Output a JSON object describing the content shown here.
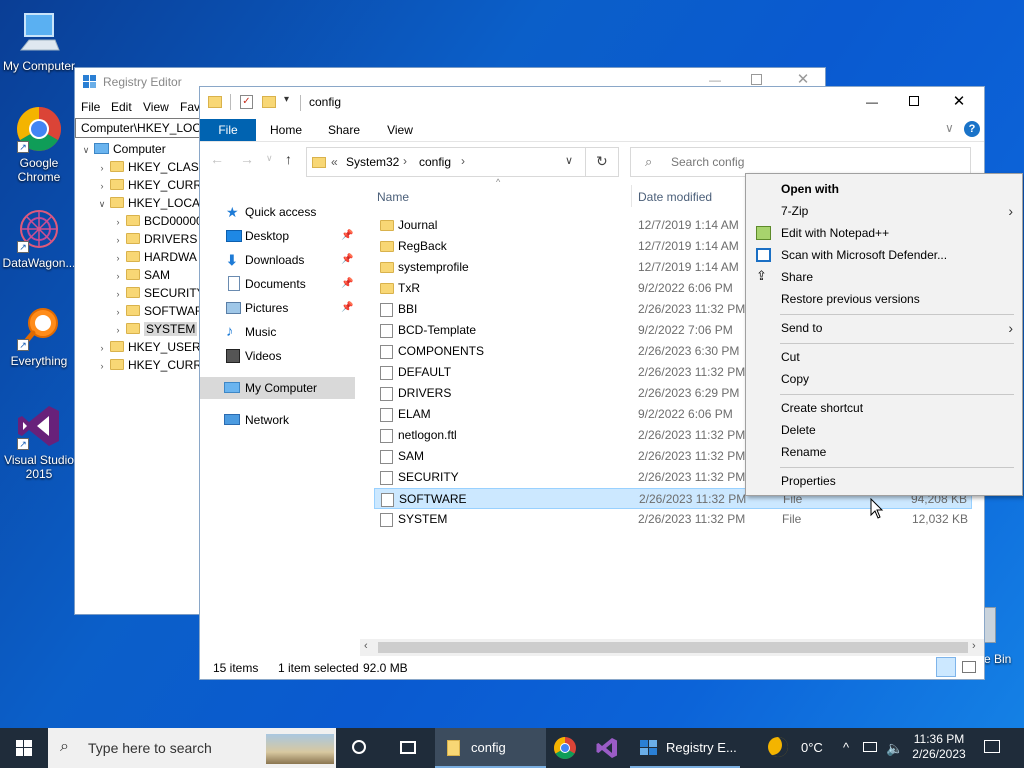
{
  "desktop": {
    "icons": [
      {
        "label": "My Computer"
      },
      {
        "label": "Google Chrome"
      },
      {
        "label": "DataWagon..."
      },
      {
        "label": "Everything"
      },
      {
        "label": "Visual Studio 2015"
      },
      {
        "label": "e Bin"
      }
    ]
  },
  "regedit": {
    "title": "Registry Editor",
    "menu": [
      "File",
      "Edit",
      "View",
      "Fav"
    ],
    "address": "Computer\\HKEY_LOCA",
    "tree": [
      {
        "label": "Computer"
      },
      {
        "label": "HKEY_CLASS"
      },
      {
        "label": "HKEY_CURRI"
      },
      {
        "label": "HKEY_LOCA"
      },
      {
        "label": "BCD00000"
      },
      {
        "label": "DRIVERS"
      },
      {
        "label": "HARDWA"
      },
      {
        "label": "SAM"
      },
      {
        "label": "SECURITY"
      },
      {
        "label": "SOFTWAR"
      },
      {
        "label": "SYSTEM"
      },
      {
        "label": "HKEY_USERS"
      },
      {
        "label": "HKEY_CURRI"
      }
    ]
  },
  "explorer": {
    "title": "config",
    "tabs": {
      "file": "File",
      "home": "Home",
      "share": "Share",
      "view": "View"
    },
    "breadcrumb": {
      "prefix": "«",
      "part1": "System32",
      "part2": "config"
    },
    "search_placeholder": "Search config",
    "nav": [
      {
        "label": "Quick access"
      },
      {
        "label": "Desktop"
      },
      {
        "label": "Downloads"
      },
      {
        "label": "Documents"
      },
      {
        "label": "Pictures"
      },
      {
        "label": "Music"
      },
      {
        "label": "Videos"
      },
      {
        "label": "My Computer"
      },
      {
        "label": "Network"
      }
    ],
    "columns": {
      "name": "Name",
      "date": "Date modified"
    },
    "files": [
      {
        "name": "Journal",
        "date": "12/7/2019 1:14 AM",
        "type": "",
        "size": ""
      },
      {
        "name": "RegBack",
        "date": "12/7/2019 1:14 AM",
        "type": "",
        "size": ""
      },
      {
        "name": "systemprofile",
        "date": "12/7/2019 1:14 AM",
        "type": "",
        "size": ""
      },
      {
        "name": "TxR",
        "date": "9/2/2022 6:06 PM",
        "type": "",
        "size": ""
      },
      {
        "name": "BBI",
        "date": "2/26/2023 11:32 PM",
        "type": "",
        "size": ""
      },
      {
        "name": "BCD-Template",
        "date": "9/2/2022 7:06 PM",
        "type": "",
        "size": ""
      },
      {
        "name": "COMPONENTS",
        "date": "2/26/2023 6:30 PM",
        "type": "",
        "size": ""
      },
      {
        "name": "DEFAULT",
        "date": "2/26/2023 11:32 PM",
        "type": "",
        "size": ""
      },
      {
        "name": "DRIVERS",
        "date": "2/26/2023 6:29 PM",
        "type": "",
        "size": ""
      },
      {
        "name": "ELAM",
        "date": "9/2/2022 6:06 PM",
        "type": "",
        "size": ""
      },
      {
        "name": "netlogon.ftl",
        "date": "2/26/2023 11:32 PM",
        "type": "",
        "size": ""
      },
      {
        "name": "SAM",
        "date": "2/26/2023 11:32 PM",
        "type": "",
        "size": ""
      },
      {
        "name": "SECURITY",
        "date": "2/26/2023 11:32 PM",
        "type": "",
        "size": ""
      },
      {
        "name": "SOFTWARE",
        "date": "2/26/2023 11:32 PM",
        "type": "File",
        "size": "94,208 KB"
      },
      {
        "name": "SYSTEM",
        "date": "2/26/2023 11:32 PM",
        "type": "File",
        "size": "12,032 KB"
      }
    ],
    "status": {
      "count": "15 items",
      "selected": "1 item selected",
      "size": "92.0 MB"
    }
  },
  "context_menu": {
    "items": [
      {
        "label": "Open with"
      },
      {
        "label": "7-Zip"
      },
      {
        "label": "Edit with Notepad++"
      },
      {
        "label": "Scan with Microsoft Defender..."
      },
      {
        "label": "Share"
      },
      {
        "label": "Restore previous versions"
      },
      {
        "label": "Send to"
      },
      {
        "label": "Cut"
      },
      {
        "label": "Copy"
      },
      {
        "label": "Create shortcut"
      },
      {
        "label": "Delete"
      },
      {
        "label": "Rename"
      },
      {
        "label": "Properties"
      }
    ]
  },
  "taskbar": {
    "search_placeholder": "Type here to search",
    "explorer_label": "config",
    "regedit_label": "Registry E...",
    "weather": "0°C",
    "time": "11:36 PM",
    "date": "2/26/2023"
  },
  "colors": {
    "accent": "#0063b1",
    "selection": "#cce8ff",
    "taskbar": "#1f2c3a"
  }
}
